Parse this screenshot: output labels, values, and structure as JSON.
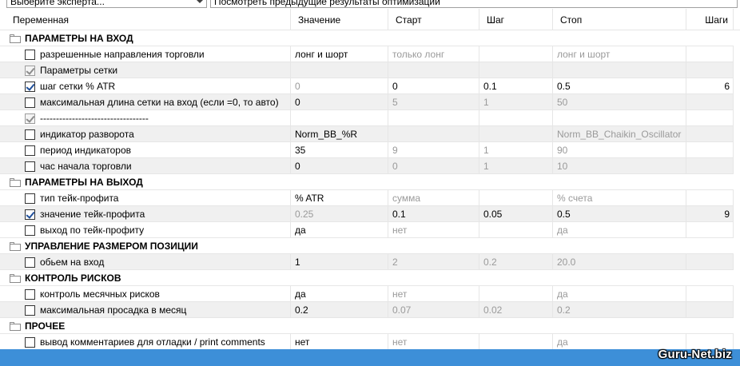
{
  "toolbar": {
    "expert_select": "Выберите эксперта...",
    "results_select": "Посмотреть предыдущие результаты оптимизации"
  },
  "columns": [
    "Переменная",
    "Значение",
    "Старт",
    "Шаг",
    "Стоп",
    "Шаги"
  ],
  "groups": [
    {
      "title": "ПАРАМЕТРЫ НА ВХОД",
      "rows": [
        {
          "name": "разрешенные направления торговли",
          "checkbox": "off",
          "value": "лонг и шорт",
          "start": "только лонг",
          "step": "",
          "stop": "лонг и шорт",
          "steps": ""
        },
        {
          "name": "Параметры сетки",
          "checkbox": "gray",
          "value": "",
          "start": "",
          "step": "",
          "stop": "",
          "steps": ""
        },
        {
          "name": "шаг сетки % ATR",
          "checkbox": "on",
          "value": "0",
          "start": "0",
          "step": "0.1",
          "stop": "0.5",
          "steps": "6"
        },
        {
          "name": "максимальная длина сетки на вход (если =0, то авто)",
          "checkbox": "off",
          "value": "0",
          "start": "5",
          "step": "1",
          "stop": "50",
          "steps": ""
        },
        {
          "name": "----------------------------------",
          "checkbox": "gray",
          "value": "",
          "start": "",
          "step": "",
          "stop": "",
          "steps": ""
        },
        {
          "name": "индикатор разворота",
          "checkbox": "off",
          "value": "Norm_BB_%R",
          "start": "",
          "step": "",
          "stop": "Norm_BB_Chaikin_Oscillator",
          "steps": ""
        },
        {
          "name": "период индикаторов",
          "checkbox": "off",
          "value": "35",
          "start": "9",
          "step": "1",
          "stop": "90",
          "steps": ""
        },
        {
          "name": "час начала торговли",
          "checkbox": "off",
          "value": "0",
          "start": "0",
          "step": "1",
          "stop": "10",
          "steps": ""
        }
      ]
    },
    {
      "title": "ПАРАМЕТРЫ НА ВЫХОД",
      "rows": [
        {
          "name": "тип тейк-профита",
          "checkbox": "off",
          "value": "% ATR",
          "start": "сумма",
          "step": "",
          "stop": "% счета",
          "steps": ""
        },
        {
          "name": "значение тейк-профита",
          "checkbox": "on",
          "value": "0.25",
          "start": "0.1",
          "step": "0.05",
          "stop": "0.5",
          "steps": "9"
        },
        {
          "name": "выход по тейк-профиту",
          "checkbox": "off",
          "value": "да",
          "start": "нет",
          "step": "",
          "stop": "да",
          "steps": ""
        }
      ]
    },
    {
      "title": "УПРАВЛЕНИЕ РАЗМЕРОМ ПОЗИЦИИ",
      "rows": [
        {
          "name": "обьем на вход",
          "checkbox": "off",
          "value": "1",
          "start": "2",
          "step": "0.2",
          "stop": "20.0",
          "steps": ""
        }
      ]
    },
    {
      "title": "КОНТРОЛЬ РИСКОВ",
      "rows": [
        {
          "name": "контроль месячных рисков",
          "checkbox": "off",
          "value": "да",
          "start": "нет",
          "step": "",
          "stop": "да",
          "steps": ""
        },
        {
          "name": "максимальная просадка в месяц",
          "checkbox": "off",
          "value": "0.2",
          "start": "0.07",
          "step": "0.02",
          "stop": "0.2",
          "steps": ""
        }
      ]
    },
    {
      "title": "ПРОЧЕЕ",
      "rows": [
        {
          "name": "вывод комментариев для отладки / print comments",
          "checkbox": "off",
          "value": "нет",
          "start": "нет",
          "step": "",
          "stop": "да",
          "steps": ""
        }
      ]
    }
  ],
  "footer": {
    "watermark": "Guru-Net.biz",
    "bar_color": "#3d8fd8"
  }
}
